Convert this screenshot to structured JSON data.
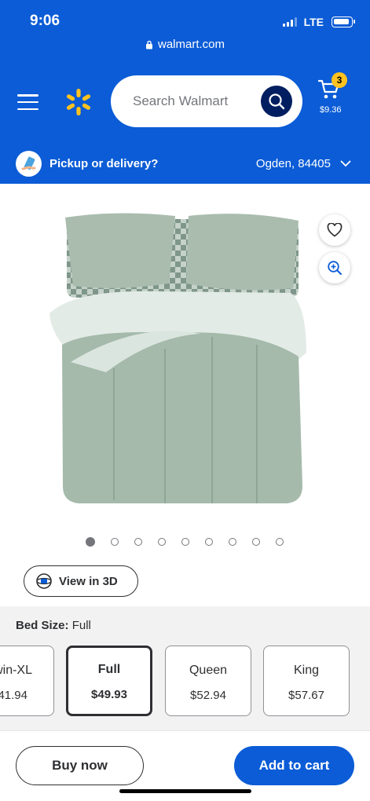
{
  "status_bar": {
    "time": "9:06",
    "network": "LTE",
    "url": "walmart.com"
  },
  "header": {
    "search_placeholder": "Search Walmart",
    "cart_count": "3",
    "cart_total": "$9.36",
    "brand_color": "#0b5cd6",
    "spark_color": "#ffc220"
  },
  "pickup": {
    "label": "Pickup or delivery?",
    "location": "Ogden, 84405"
  },
  "gallery": {
    "image_count": 9,
    "active_index": 0
  },
  "view3d": {
    "label": "View in 3D"
  },
  "bed_size": {
    "heading": "Bed Size:",
    "selected": "Full",
    "options": [
      {
        "name": "win-XL",
        "price": "41.94"
      },
      {
        "name": "Full",
        "price": "$49.93",
        "selected": true
      },
      {
        "name": "Queen",
        "price": "$52.94"
      },
      {
        "name": "King",
        "price": "$57.67"
      }
    ]
  },
  "actions": {
    "buy_now": "Buy now",
    "add_to_cart": "Add to cart"
  }
}
